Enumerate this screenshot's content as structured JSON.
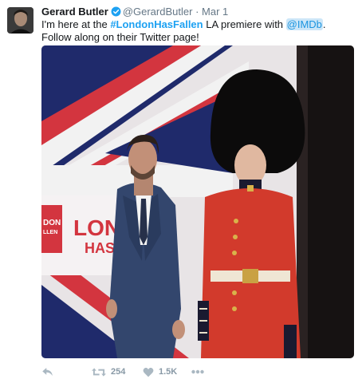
{
  "tweet": {
    "author_name": "Gerard Butler",
    "author_handle": "@GerardButler",
    "separator": "·",
    "date": "Mar 1",
    "verified": true,
    "text_intro": "I'm here at the ",
    "hashtag": "#LondonHasFallen",
    "text_middle": " LA premiere with ",
    "mention": "@IMDb",
    "text_outro": ". Follow along on their Twitter page!"
  },
  "media": {
    "backdrop_text_left": "DON",
    "backdrop_text_left_sub": "LLEN",
    "backdrop_title_line1": "LON",
    "backdrop_title_line2": "HAS"
  },
  "actions": {
    "retweet_count": "254",
    "like_count": "1.5K"
  },
  "colors": {
    "link": "#1da1f2",
    "mention_bg": "#cce6f8",
    "secondary_text": "#657786",
    "action_icon": "#aab8c2",
    "flag_red": "#d3353f",
    "flag_blue": "#1f2a6b",
    "guard_red": "#d23a2c"
  },
  "icons": [
    "verified-icon",
    "reply-icon",
    "retweet-icon",
    "like-icon",
    "more-icon"
  ]
}
